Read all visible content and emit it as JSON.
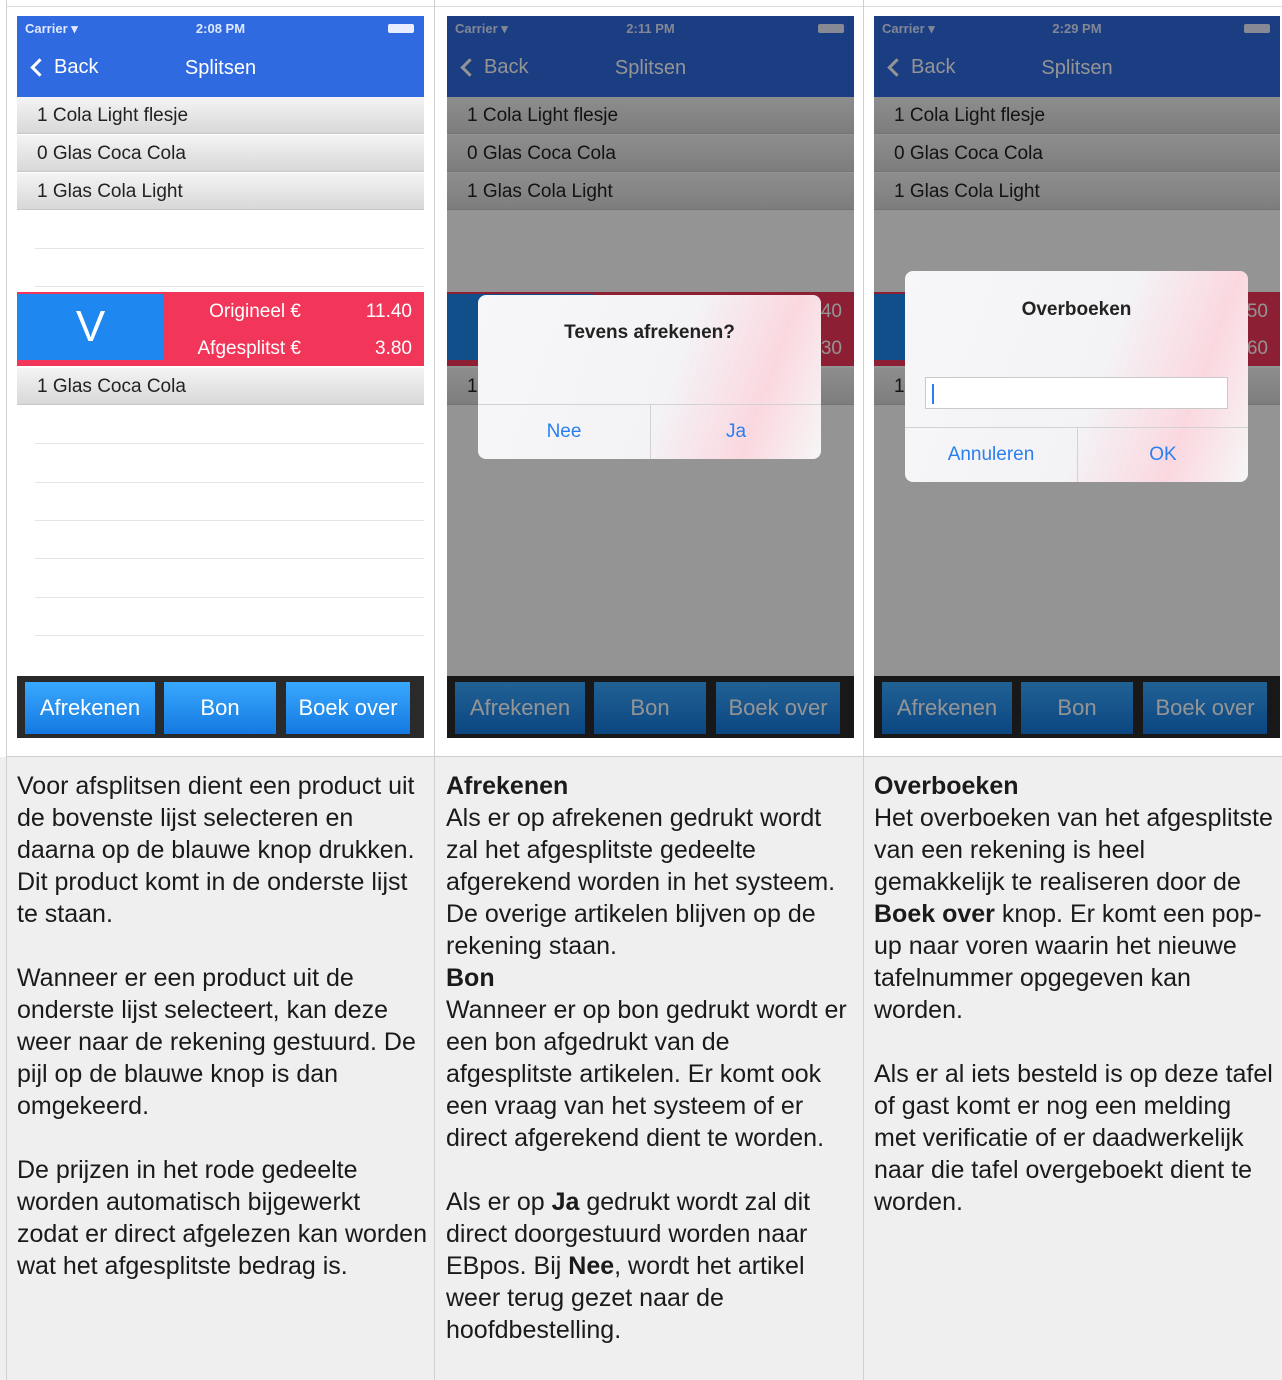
{
  "app": {
    "status_carrier": "Carrier ▾",
    "nav_back": "Back",
    "nav_title": "Splitsen",
    "toolbar": {
      "afrekenen": "Afrekenen",
      "bon": "Bon",
      "boek_over": "Boek over"
    },
    "top_list": [
      "1 Cola Light flesje",
      "0 Glas Coca Cola",
      "1 Glas Cola Light"
    ],
    "bottom_list": [
      "1 Glas Coca Cola"
    ],
    "split": {
      "arrow": "V",
      "origineel_label": "Origineel €",
      "origineel_value": "11.40",
      "afgesplitst_label": "Afgesplitst €",
      "afgesplitst_value": "3.80"
    }
  },
  "screens": [
    {
      "time": "2:08 PM"
    },
    {
      "time": "2:11 PM",
      "alert": {
        "title": "Tevens afrekenen?",
        "left": "Nee",
        "right": "Ja"
      },
      "peek_values": [
        "40",
        "30"
      ],
      "peek_row": "1"
    },
    {
      "time": "2:29 PM",
      "alert": {
        "title": "Overboeken",
        "left": "Annuleren",
        "right": "OK"
      },
      "peek_values": [
        "50",
        "60"
      ],
      "peek_row": "1"
    }
  ],
  "descriptions": {
    "col1": {
      "p1": "Voor afsplitsen dient een product uit de bovenste lijst selecteren en daarna op de blauwe knop drukken. Dit product komt in de onderste lijst te staan.",
      "p2": "Wanneer er een product uit de onderste lijst selecteert, kan deze weer naar de rekening gestuurd. De pijl op de blauwe knop is dan omgekeerd.",
      "p3": "De prijzen in het rode gedeelte worden automatisch bijgewerkt zodat er direct afgelezen kan worden wat het afgesplitste bedrag is."
    },
    "col2": {
      "h1": "Afrekenen",
      "p1": "Als er op afrekenen gedrukt wordt zal het afgesplitste gedeelte afgerekend worden in het systeem. De overige artikelen blijven op de rekening staan.",
      "h2": "Bon",
      "p2": "Wanneer er op bon gedrukt wordt er een bon afgedrukt van de afgesplitste artikelen. Er komt ook een vraag van het systeem of er direct afgerekend dient te worden.",
      "p3_a": "Als er op ",
      "p3_ja": "Ja",
      "p3_b": "  gedrukt wordt zal dit direct doorgestuurd worden naar EBpos. Bij ",
      "p3_nee": "Nee",
      "p3_c": ", wordt het artikel weer terug gezet naar de hoofdbestelling."
    },
    "col3": {
      "h1": "Overboeken",
      "p1_a": "Het overboeken van het afgesplitste van een rekening is heel gemakkelijk te realiseren door de ",
      "p1_b": "Boek over",
      "p1_c": " knop. Er komt een pop-up naar voren waarin het nieuwe tafelnummer opgegeven kan worden.",
      "p2": "Als er al iets besteld is op deze tafel of gast komt er nog een melding met verificatie of er daadwerkelijk naar die tafel overgeboekt dient te worden."
    }
  },
  "colors": {
    "navbar": "#2f6ae0",
    "split_bar": "#f2365a",
    "arrow_button": "#1e88f0",
    "toolbar_button": "#1f8ff5",
    "alert_button_text": "#2a7ff0"
  }
}
